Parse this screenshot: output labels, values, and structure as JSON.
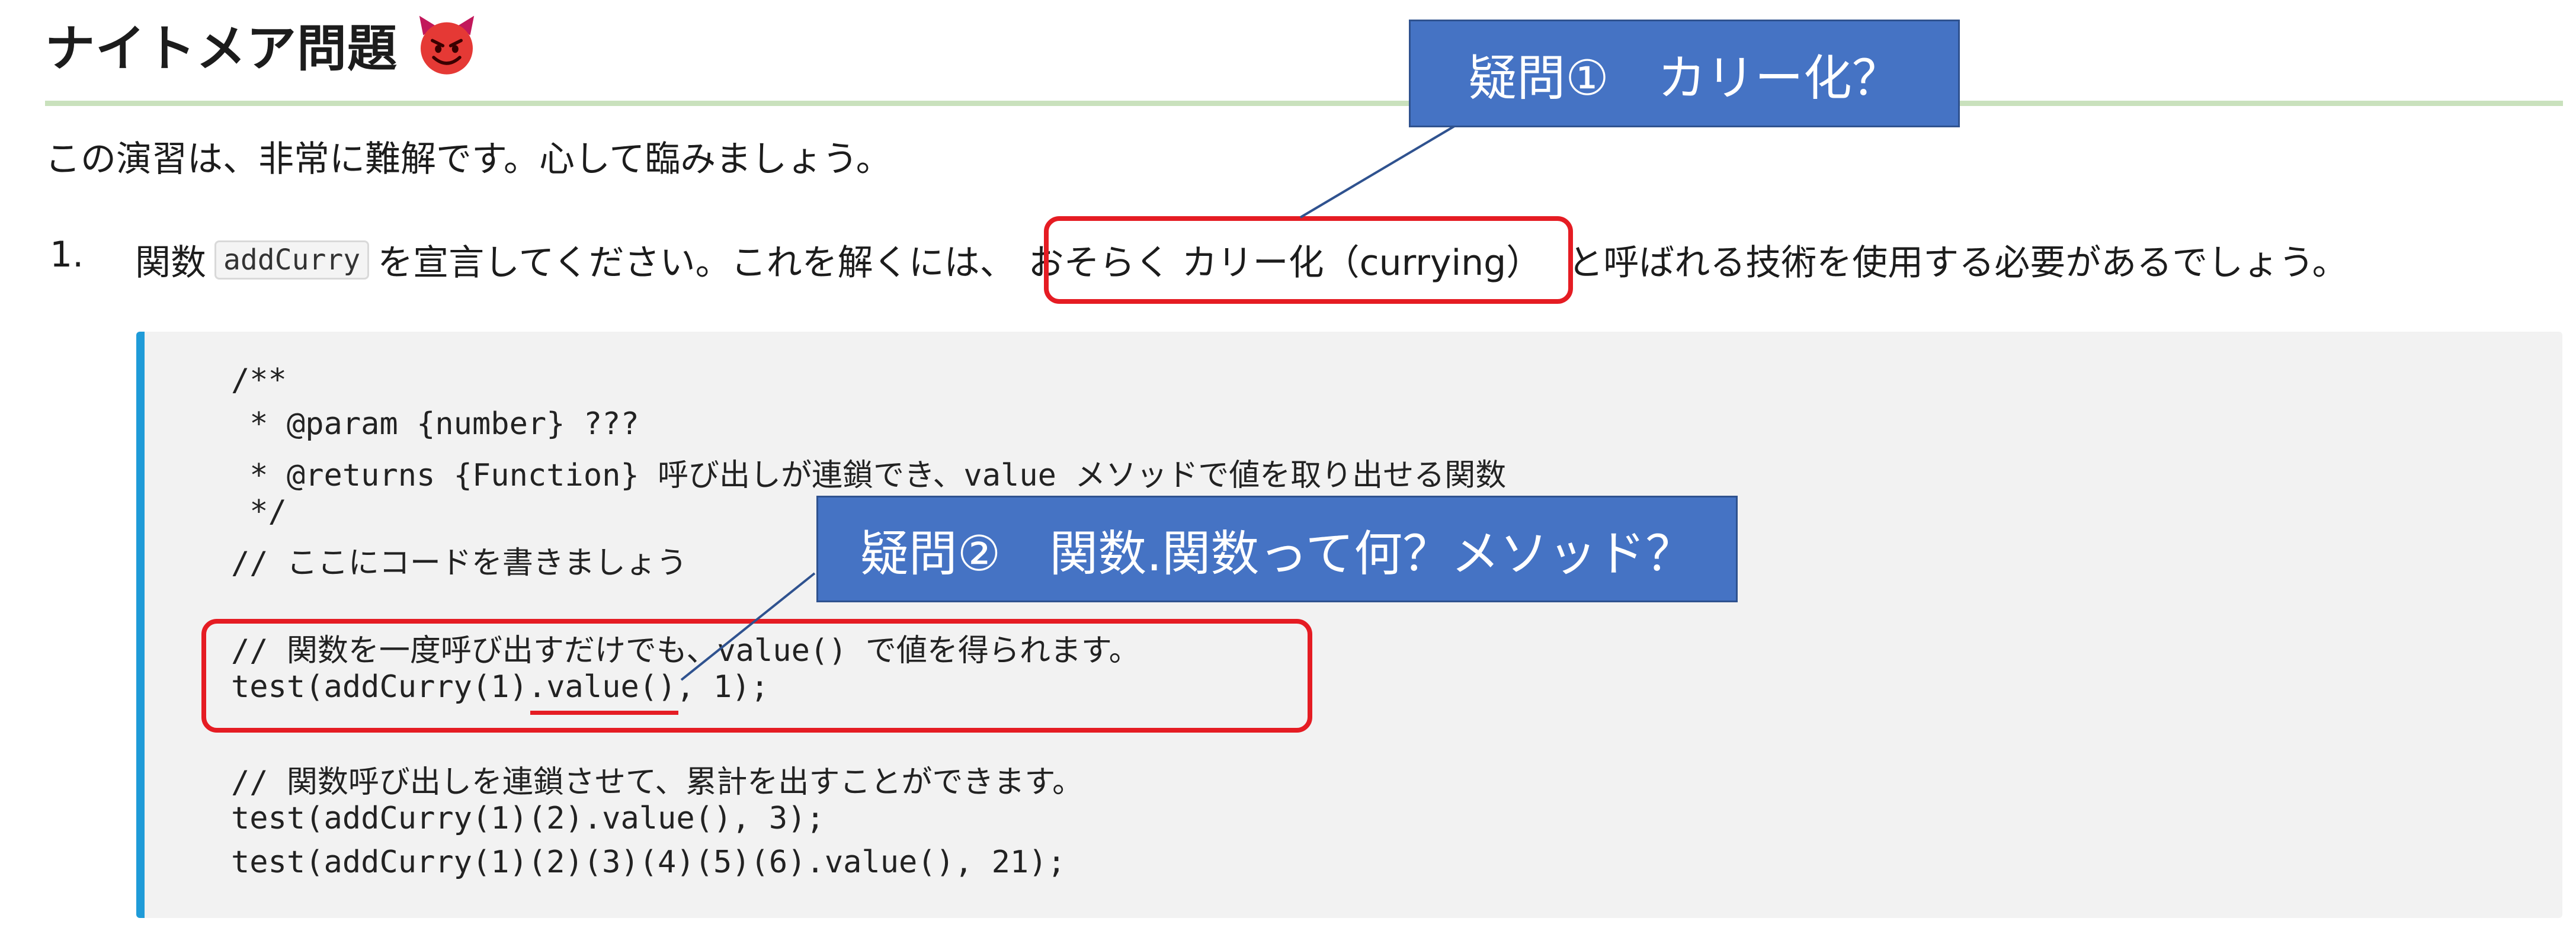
{
  "heading": {
    "title": "ナイトメア問題",
    "icon": "smiling-devil-icon"
  },
  "intro": "この演習は、非常に難解です。心して臨みましょう。",
  "item": {
    "number": "1.",
    "before": "関数",
    "code": "addCurry",
    "middle": "を宣言してください。これを解くには、",
    "highlight": "おそらく カリー化（currying）",
    "after": "と呼ばれる技術を使用する必要があるでしょう。"
  },
  "code_lines": [
    "/**",
    " * @param {number} ???",
    " * @returns {Function} 呼び出しが連鎖でき、value メソッドで値を取り出せる関数",
    " */",
    "// ここにコードを書きましょう",
    "",
    "// 関数を一度呼び出すだけでも、value() で値を得られます。",
    "test(addCurry(1).value(), 1);",
    "",
    "// 関数呼び出しを連鎖させて、累計を出すことができます。",
    "test(addCurry(1)(2).value(), 3);",
    "test(addCurry(1)(2)(3)(4)(5)(6).value(), 21);"
  ],
  "callouts": {
    "q1": "疑問①　カリー化？",
    "q2": "疑問②　関数.関数って何？メソッド？"
  },
  "colors": {
    "accent_border": "#1f9bd8",
    "annotation_red": "#e51c23",
    "callout_blue": "#4573c4",
    "heading_rule": "#c9e1bd"
  }
}
